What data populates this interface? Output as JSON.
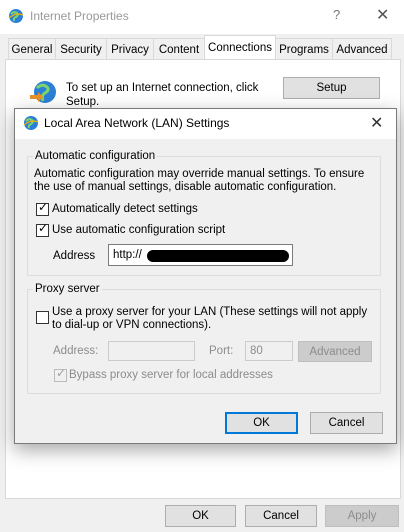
{
  "outer_window": {
    "title": "Internet Properties",
    "help_glyph": "?",
    "close_glyph": "✕",
    "tabs": [
      {
        "label": "General"
      },
      {
        "label": "Security"
      },
      {
        "label": "Privacy"
      },
      {
        "label": "Content"
      },
      {
        "label": "Connections",
        "active": true
      },
      {
        "label": "Programs"
      },
      {
        "label": "Advanced"
      }
    ],
    "setup_text": "To set up an Internet connection, click Setup.",
    "setup_button": "Setup",
    "buttons": {
      "ok": "OK",
      "cancel": "Cancel",
      "apply": "Apply"
    }
  },
  "lan_dialog": {
    "title": "Local Area Network (LAN) Settings",
    "close_glyph": "✕",
    "automatic": {
      "legend": "Automatic configuration",
      "description": "Automatic configuration may override manual settings.  To ensure the use of manual settings, disable automatic configuration.",
      "auto_detect": {
        "label": "Automatically detect settings",
        "checked": true
      },
      "auto_script": {
        "label": "Use automatic configuration script",
        "checked": true
      },
      "address_label": "Address",
      "address_value": "http://"
    },
    "proxy": {
      "legend": "Proxy server",
      "use_proxy": {
        "label": "Use a proxy server for your LAN (These settings will not apply to dial-up or VPN connections).",
        "checked": false
      },
      "address_label": "Address:",
      "address_value": "",
      "port_label": "Port:",
      "port_value": "80",
      "advanced_button": "Advanced",
      "bypass": {
        "label": "Bypass proxy server for local addresses",
        "checked": true,
        "disabled": true
      }
    },
    "buttons": {
      "ok": "OK",
      "cancel": "Cancel"
    }
  },
  "check_glyph": "✓",
  "colors": {
    "accent": "#0078d7",
    "globe": "#2a7fd6",
    "arrow": "#2e9c3a"
  }
}
